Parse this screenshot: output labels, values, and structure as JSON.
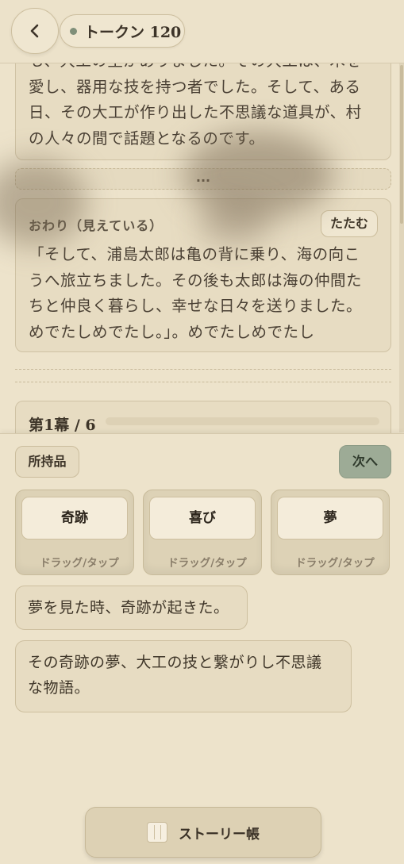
{
  "header": {
    "back_icon": "chevron-left-icon",
    "token_label": "トークン 120",
    "token_dot_color": "#7f8f79"
  },
  "story": {
    "previous_passage": "も、大工の里がありました。その大工は、木を愛し、器用な技を持つ者でした。そして、ある日、その大工が作り出した不思議な道具が、村の人々の間で話題となるのです。",
    "previous_lines": [
      "も、大工の里がありました。その大工は、木を",
      "愛し、器用な技を持つ者でした。そして、ある",
      "日、その大工が作り出した不思議な道具が、村",
      "の人々の間で話題となるのです。"
    ],
    "ellipsis": "...",
    "ending_label": "おわり（見えている）",
    "collapse_label": "たたむ",
    "ending_lines": [
      "「そして、浦島太郎は亀の背に乗り、海の向こ",
      "うへ旅立ちました。その後も太郎は海の仲間た",
      "ちと仲良く暮らし、幸せな日々を送りました。",
      "めでたしめでたし。」。めでたしめでたし"
    ],
    "act_label": "第1幕 / 6",
    "act_progress": 0
  },
  "panel": {
    "holdings_label": "所持品",
    "next_label": "次へ",
    "words": [
      {
        "word": "奇跡",
        "hint": "ドラッグ/タップ"
      },
      {
        "word": "喜び",
        "hint": "ドラッグ/タップ"
      },
      {
        "word": "夢",
        "hint": "ドラッグ/タップ"
      }
    ],
    "sentences": [
      "夢を見た時、奇跡が起きた。",
      "その奇跡の夢、大工の技と繋がりし不思議な物語。"
    ],
    "sentence_2_lines": [
      "その奇跡の夢、大工の技と繋がりし不思議",
      "な物語。"
    ],
    "storybook_label": "ストーリー帳",
    "storybook_icon": "book-icon"
  }
}
